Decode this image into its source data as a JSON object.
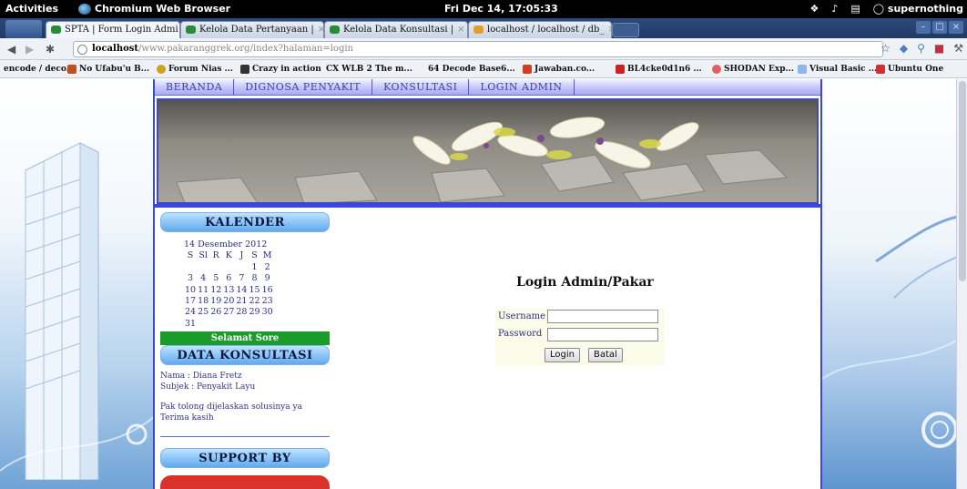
{
  "system": {
    "activities": "Activities",
    "app_name": "Chromium Web Browser",
    "clock": "Fri Dec 14, 17:05:33",
    "user": "supernothing"
  },
  "browser": {
    "tabs": [
      {
        "label": "SPTA | Form Login Admi",
        "active": true
      },
      {
        "label": "Kelola Data Pertanyaan |",
        "active": false
      },
      {
        "label": "Kelola Data Konsultasi |",
        "active": false
      },
      {
        "label": "localhost / localhost / db_",
        "active": false
      }
    ],
    "url_host": "localhost",
    "url_rest": "/www.pakaranggrek.org/index?halaman=login",
    "bookmarks": [
      {
        "label": "encode / deco...",
        "color": "#999999"
      },
      {
        "label": "No Ufabu'u B...",
        "color": "#c05020"
      },
      {
        "label": "Forum Nias ...",
        "color": "#d0a020"
      },
      {
        "label": "Crazy in action",
        "color": "#333333"
      },
      {
        "label": "CX WLB 2 The m...",
        "color": "#eef1f6"
      },
      {
        "label": "64 Decode Base6...",
        "color": "#eef1f6"
      },
      {
        "label": "Jawaban.co...",
        "color": "#d04020"
      },
      {
        "label": "BL4cke0d1n6 ...",
        "color": "#d02020"
      },
      {
        "label": "SHODAN Exp...",
        "color": "#e06060"
      },
      {
        "label": "Visual Basic ...",
        "color": "#8ab8e8"
      },
      {
        "label": "Ubuntu One",
        "color": "#d03030"
      }
    ]
  },
  "site": {
    "menu": [
      "BERANDA",
      "DIGNOSA PENYAKIT",
      "KONSULTASI",
      "LOGIN ADMIN"
    ],
    "calendar": {
      "heading": "KALENDER",
      "date_title": "14 Desember 2012",
      "days": [
        "S",
        "Sl",
        "R",
        "K",
        "J",
        "S",
        "M"
      ],
      "weeks": [
        [
          "",
          "",
          "",
          "",
          "",
          "1",
          "2"
        ],
        [
          "3",
          "4",
          "5",
          "6",
          "7",
          "8",
          "9"
        ],
        [
          "10",
          "11",
          "12",
          "13",
          "14",
          "15",
          "16"
        ],
        [
          "17",
          "18",
          "19",
          "20",
          "21",
          "22",
          "23"
        ],
        [
          "24",
          "25",
          "26",
          "27",
          "28",
          "29",
          "30"
        ],
        [
          "31",
          "",
          "",
          "",
          "",
          "",
          ""
        ]
      ]
    },
    "greeting": "Selamat Sore",
    "consult": {
      "heading": "DATA KONSULTASI",
      "name": "Nama : Diana Fretz",
      "subject": "Subjek : Penyakit Layu",
      "message": "Pak tolong dijelaskan solusinya ya Terima kasih"
    },
    "support_heading": "SUPPORT BY",
    "login": {
      "title": "Login Admin/Pakar",
      "username_label": "Username",
      "password_label": "Password",
      "login_button": "Login",
      "cancel_button": "Batal"
    }
  }
}
